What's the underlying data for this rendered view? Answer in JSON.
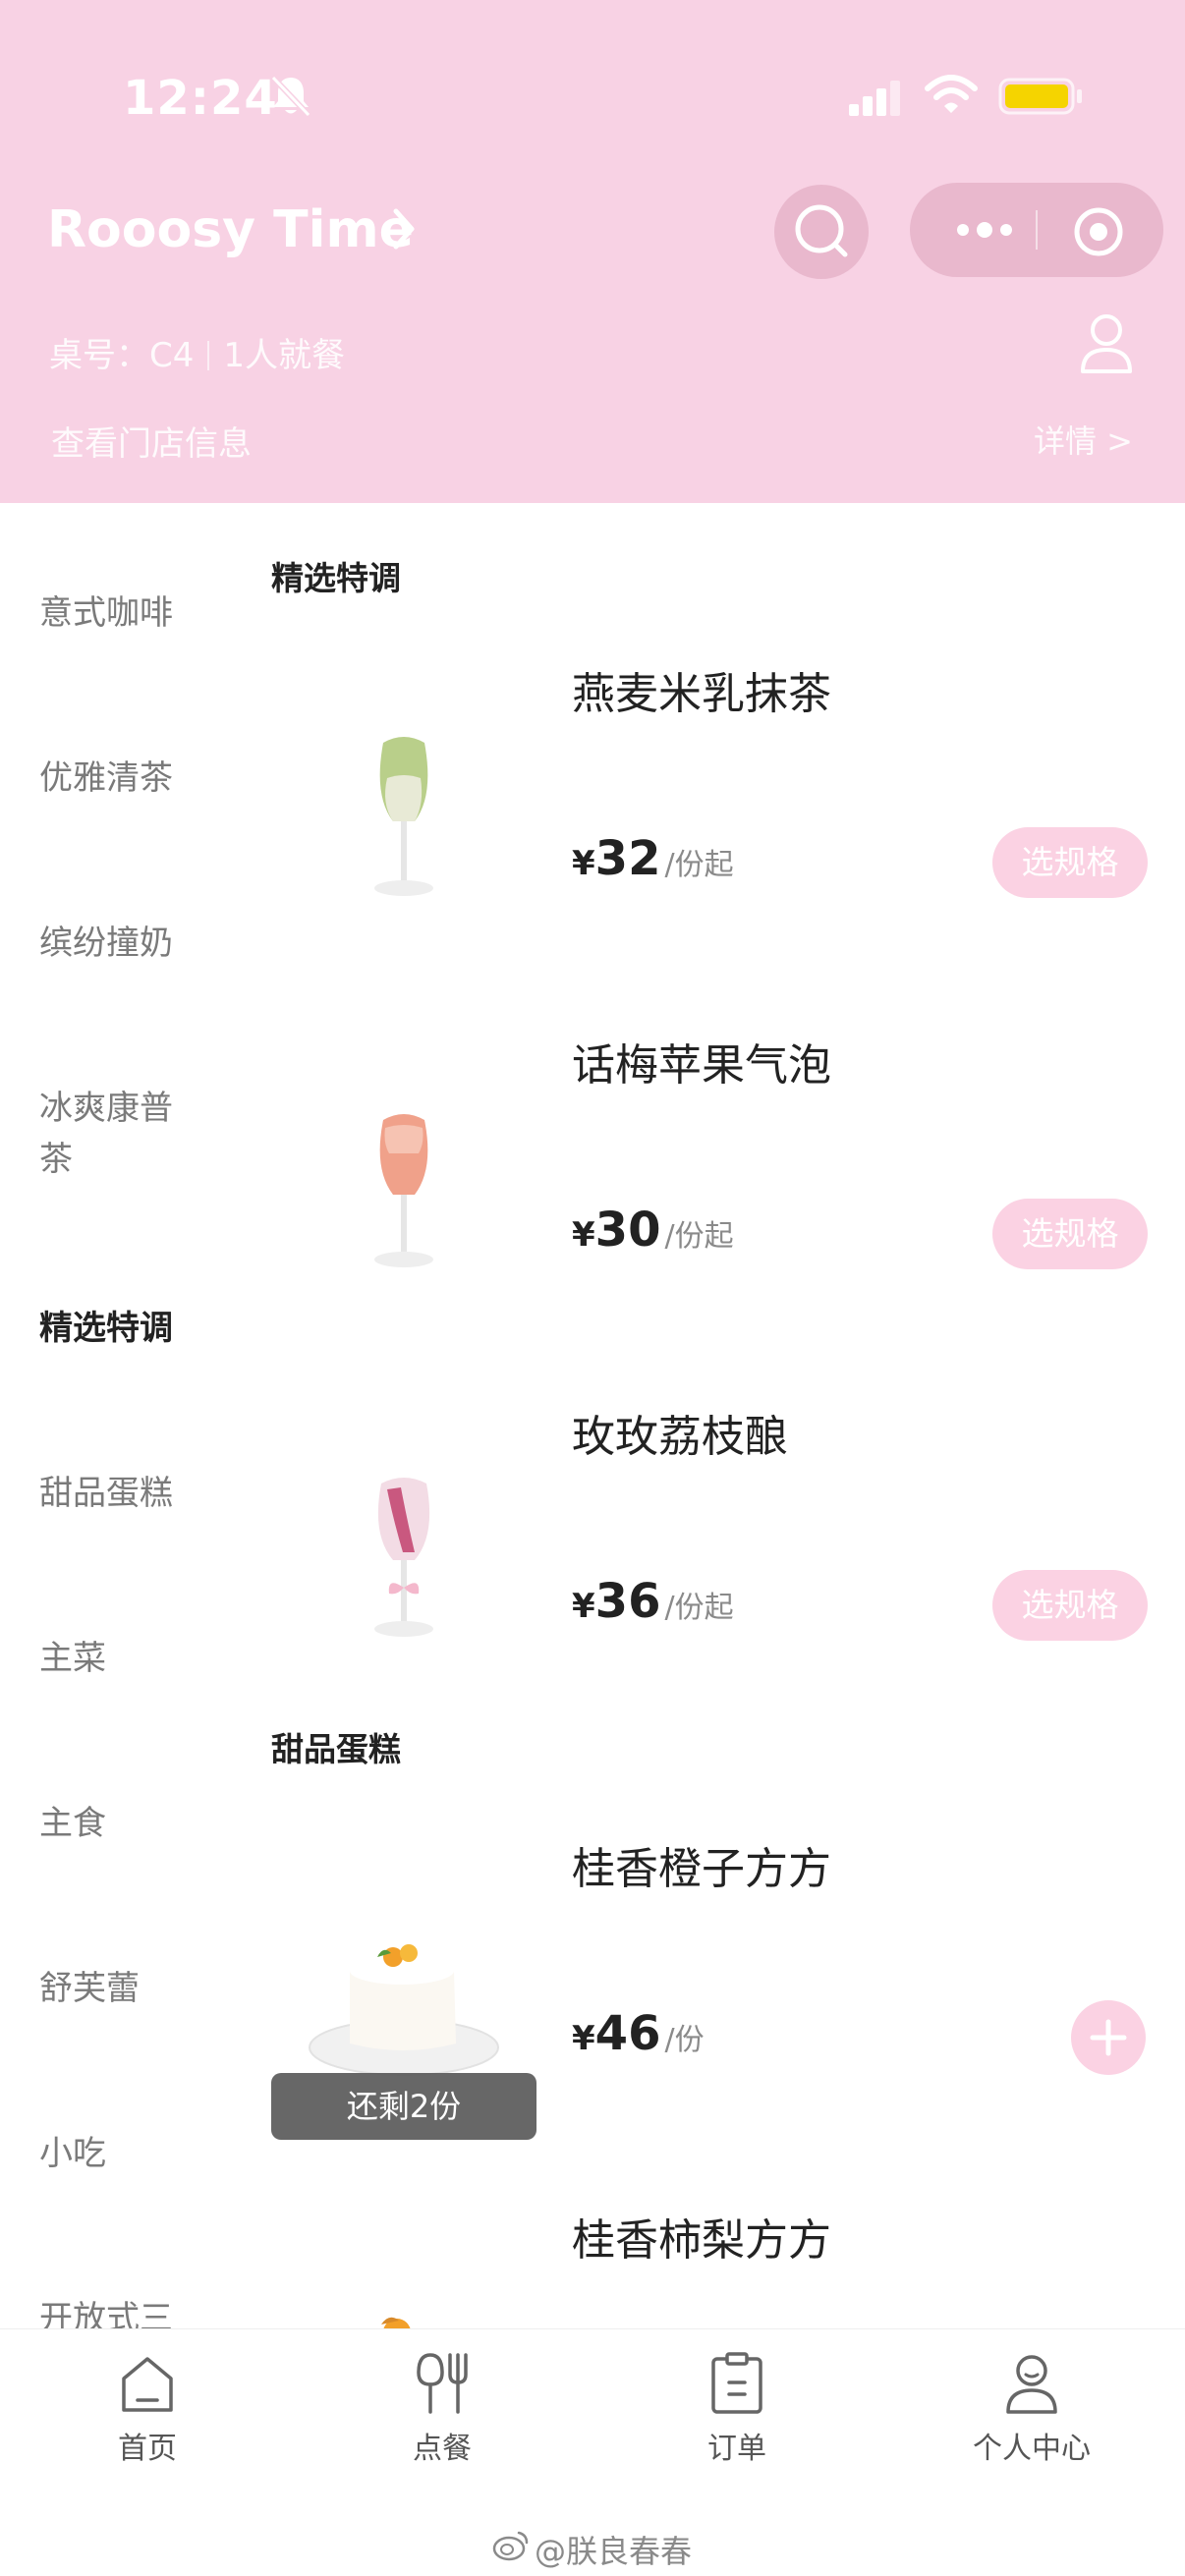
{
  "status_bar": {
    "time": "12:24"
  },
  "header": {
    "store_name": "Rooosy Time",
    "table_label": "桌号：C4",
    "diners": "1人就餐",
    "store_info_link": "查看门店信息",
    "detail_link": "详情 >"
  },
  "sidebar": {
    "categories": [
      "意式咖啡",
      "优雅清茶",
      "缤纷撞奶",
      "冰爽康普茶",
      "精选特调",
      "甜品蛋糕",
      "主菜",
      "主食",
      "舒芙蕾",
      "小吃",
      "开放式三"
    ],
    "active_index": 4
  },
  "sections": [
    {
      "title": "精选特调"
    },
    {
      "title": "甜品蛋糕"
    }
  ],
  "products": [
    {
      "name": "燕麦米乳抹茶",
      "yen": "¥",
      "price": "32",
      "unit": "/份起",
      "action": "选规格"
    },
    {
      "name": "话梅苹果气泡",
      "yen": "¥",
      "price": "30",
      "unit": "/份起",
      "action": "选规格"
    },
    {
      "name": "玫玫荔枝酿",
      "yen": "¥",
      "price": "36",
      "unit": "/份起",
      "action": "选规格"
    },
    {
      "name": "桂香橙子方方",
      "yen": "¥",
      "price": "46",
      "unit": "/份",
      "remaining": "还剩2份"
    },
    {
      "name": "桂香柿梨方方"
    }
  ],
  "tabbar": {
    "items": [
      "首页",
      "点餐",
      "订单",
      "个人中心"
    ]
  },
  "watermark": "@朕良春春",
  "colors": {
    "header_bg": "#f8d2e4",
    "button_pink": "#fbd2e3"
  }
}
